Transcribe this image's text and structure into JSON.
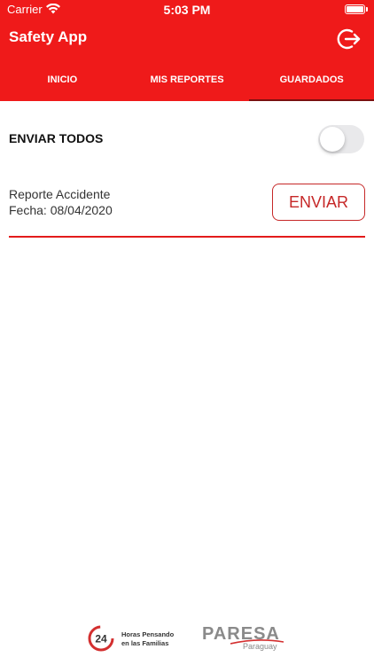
{
  "status_bar": {
    "carrier": "Carrier",
    "time": "5:03 PM"
  },
  "header": {
    "title": "Safety App",
    "logout_icon": "logout-icon"
  },
  "tabs": [
    {
      "label": "INICIO",
      "active": false
    },
    {
      "label": "MIS REPORTES",
      "active": false
    },
    {
      "label": "GUARDADOS",
      "active": true
    }
  ],
  "send_all": {
    "label": "ENVIAR TODOS",
    "toggle_on": false
  },
  "reports": [
    {
      "title": "Reporte Accidente",
      "date": "Fecha: 08/04/2020",
      "button_label": "ENVIAR"
    }
  ],
  "footer": {
    "logo24_number": "24",
    "logo24_line1": "Horas Pensando",
    "logo24_line2": "en las Familias",
    "paresa_name": "PARESA",
    "paresa_country": "Paraguay"
  },
  "colors": {
    "primary": "#ef1a1a",
    "accent": "#c62828"
  }
}
